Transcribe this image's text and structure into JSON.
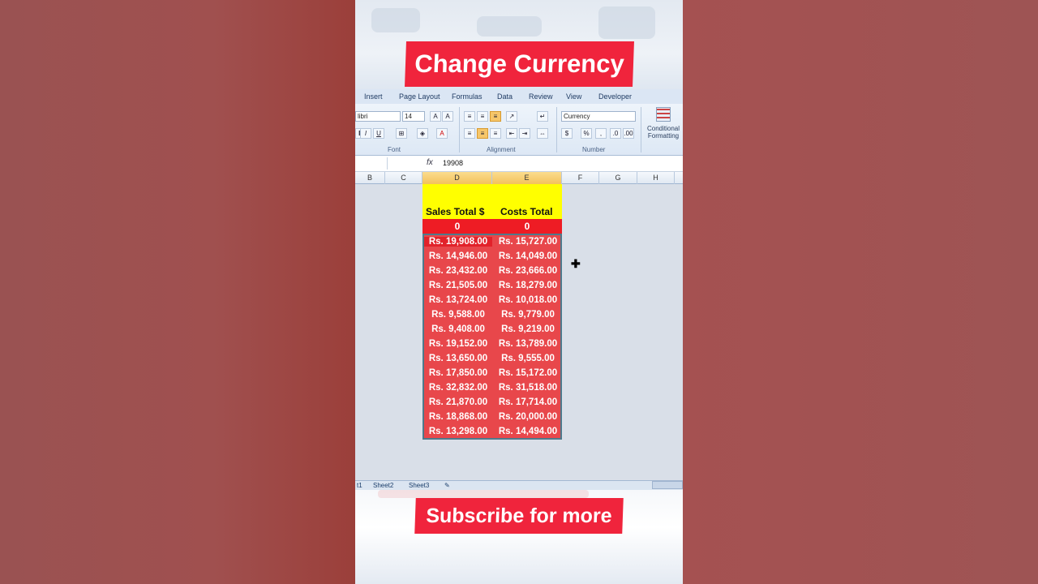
{
  "overlay": {
    "title": "Change Currency",
    "subscribe": "Subscribe for more"
  },
  "ribbon": {
    "tabs": [
      "Insert",
      "Page Layout",
      "Formulas",
      "Data",
      "Review",
      "View",
      "Developer"
    ],
    "font_name": "libri",
    "font_size": "14",
    "number_format": "Currency",
    "group_labels": [
      "Font",
      "Alignment",
      "Number"
    ],
    "conditional_formatting": [
      "Conditional",
      "Formatting"
    ]
  },
  "formula_bar": {
    "fx": "fx",
    "value": "19908"
  },
  "columns": [
    "B",
    "C",
    "D",
    "E",
    "F",
    "G",
    "H"
  ],
  "sheet": {
    "header_d": "Sales Total $",
    "header_e": "Costs Total",
    "zero_d": "0",
    "zero_e": "0",
    "rows": [
      [
        "Rs. 19,908.00",
        "Rs. 15,727.00"
      ],
      [
        "Rs. 14,946.00",
        "Rs. 14,049.00"
      ],
      [
        "Rs. 23,432.00",
        "Rs. 23,666.00"
      ],
      [
        "Rs. 21,505.00",
        "Rs. 18,279.00"
      ],
      [
        "Rs. 13,724.00",
        "Rs. 10,018.00"
      ],
      [
        "Rs. 9,588.00",
        "Rs. 9,779.00"
      ],
      [
        "Rs. 9,408.00",
        "Rs. 9,219.00"
      ],
      [
        "Rs. 19,152.00",
        "Rs. 13,789.00"
      ],
      [
        "Rs. 13,650.00",
        "Rs. 9,555.00"
      ],
      [
        "Rs. 17,850.00",
        "Rs. 15,172.00"
      ],
      [
        "Rs. 32,832.00",
        "Rs. 31,518.00"
      ],
      [
        "Rs. 21,870.00",
        "Rs. 17,714.00"
      ],
      [
        "Rs. 18,868.00",
        "Rs. 20,000.00"
      ],
      [
        "Rs. 13,298.00",
        "Rs. 14,494.00"
      ]
    ]
  },
  "sheet_tabs": [
    "t1",
    "Sheet2",
    "Sheet3"
  ]
}
